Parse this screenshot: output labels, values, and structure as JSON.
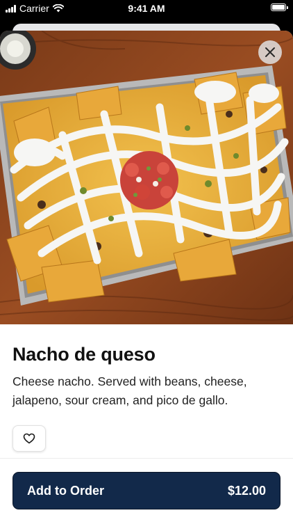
{
  "status_bar": {
    "carrier": "Carrier",
    "time": "9:41 AM"
  },
  "item": {
    "name": "Nacho de queso",
    "description": "Cheese nacho. Served with beans, cheese, jalapeno, sour cream, and pico de gallo."
  },
  "actions": {
    "add_label": "Add to Order",
    "price": "$12.00"
  },
  "icons": {
    "close": "close-icon",
    "favorite": "heart-outline-icon",
    "wifi": "wifi-icon",
    "battery": "battery-icon",
    "signal": "signal-bars-icon"
  },
  "colors": {
    "primary_button": "#12294a",
    "title_text": "#111111",
    "close_button_bg": "#e1e1e1"
  }
}
